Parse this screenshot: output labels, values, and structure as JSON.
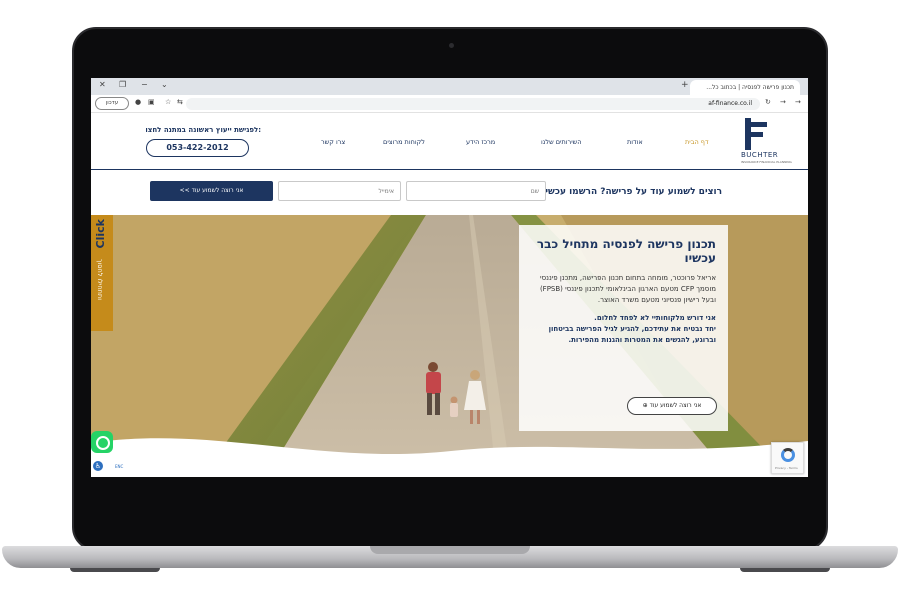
{
  "browser": {
    "tab_title": "תכנון פרישה לפנסיה | בכתוב כל...",
    "url": "af-finance.co.il",
    "update_label": "עדכון"
  },
  "header": {
    "brand": "BUCHTER",
    "brand_tagline": "INSURANCE  FINANCIAL  PLANNING",
    "nav": [
      "דף הבית",
      "אודות",
      "השירותים שלנו",
      "מרכז הידע",
      "לקוחות מרוצים",
      "צרו קשר"
    ],
    "cta_title": "לפגישת ייעוץ ראשונה במתנה לחצו:",
    "phone": "053-422-2012"
  },
  "lead_form": {
    "title": "רוצים לשמוע עוד על פרישה? הרשמו עכשיו!",
    "name_placeholder": "שם",
    "email_placeholder": "אימייל",
    "submit_label": "אני רוצה לשמוע עוד >>"
  },
  "hero": {
    "title": "תכנון פרישה לפנסיה מתחיל כבר עכשיו",
    "body": "אריאל פרוכטר, מומחה בתחום תכנון הפרישה, מתכנן פיננסי מוסמך CFP מטעם הארגון הבינלאומי לתכנון פיננסי (FPSB) ובעל רישיון פנסיוני מטעם משרד האוצר.",
    "bold_1": "אני דורש מלקוחותיי לא לפחד לחלום.",
    "bold_2": "יחד נבטיח את עתידכם, להגיע לגיל הפרישה בביטחון וברוגע, להגשים את המטרות והגנות מהפירות.",
    "button_label": "אני רוצה לשמוע עוד"
  },
  "side_tab": {
    "click_label": "Click",
    "text": "ותתחילו לחסוך"
  },
  "widgets": {
    "accessibility_label": "ENC",
    "recaptcha_label": "Privacy - Terms"
  },
  "colors": {
    "brand_navy": "#1d3560",
    "accent_gold": "#c99a2e",
    "whatsapp": "#25d366"
  }
}
